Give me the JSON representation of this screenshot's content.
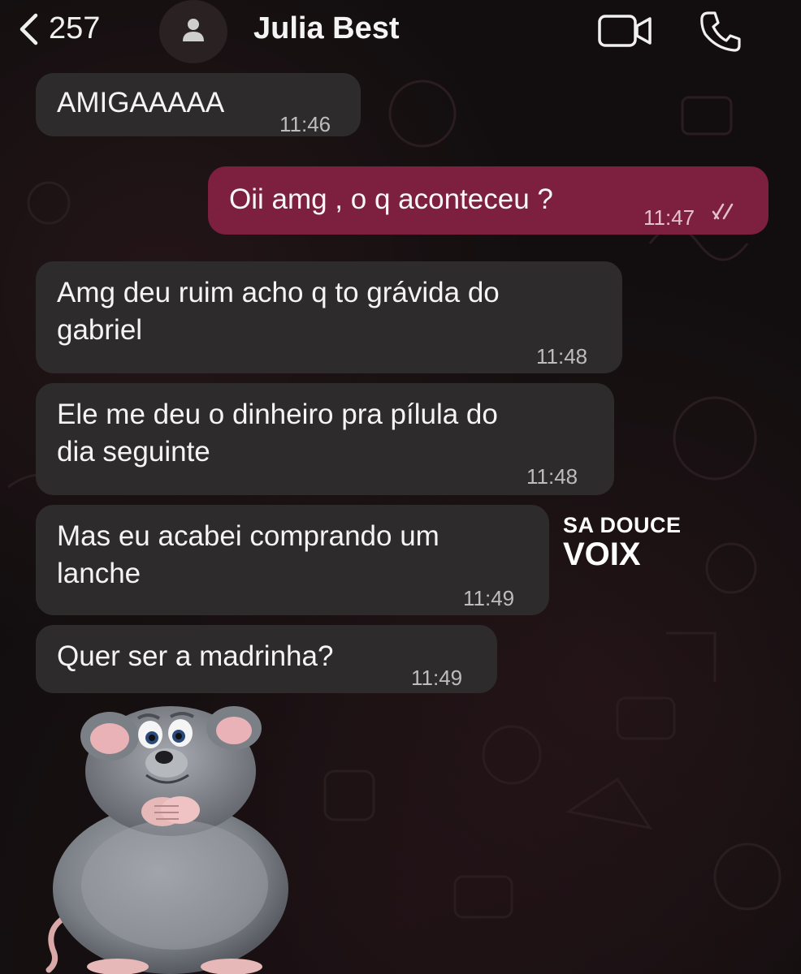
{
  "header": {
    "back_count": "257",
    "contact_name": "Julia Best",
    "icons": [
      "chevron-left-icon",
      "person-icon",
      "video-call-icon",
      "phone-icon"
    ]
  },
  "messages": [
    {
      "text": "AMIGAAAAA",
      "time": "11:46",
      "direction": "incoming"
    },
    {
      "text": "Oii amg , o q aconteceu ?",
      "time": "11:47",
      "direction": "outgoing",
      "read": true
    },
    {
      "text": "Amg deu ruim acho q to grávida do\ngabriel",
      "time": "11:48",
      "direction": "incoming"
    },
    {
      "text": "Ele me deu o dinheiro pra pílula do\ndia seguinte",
      "time": "11:48",
      "direction": "incoming"
    },
    {
      "text": "Mas eu acabei comprando um\nlanche",
      "time": "11:49",
      "direction": "incoming"
    },
    {
      "text": "Quer ser a madrinha?",
      "time": "11:49",
      "direction": "incoming"
    }
  ],
  "watermark": {
    "line1": "SA DOUCE",
    "line2": "VOIX"
  },
  "sticker": {
    "name": "rat-sticker"
  },
  "colors": {
    "background": "#120e0f",
    "incoming_bubble": "#2e2b2c",
    "outgoing_bubble": "#7d1f3f",
    "timestamp": "#bdbdbd"
  }
}
